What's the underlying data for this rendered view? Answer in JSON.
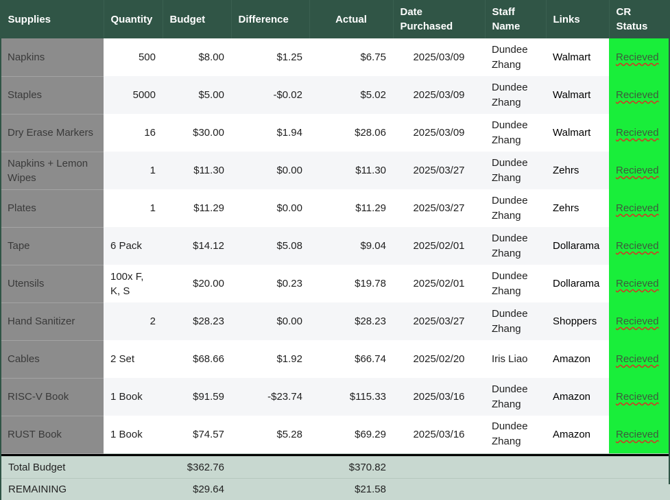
{
  "headers": {
    "supplies": "Supplies",
    "quantity": "Quantity",
    "budget": "Budget",
    "difference": "Difference",
    "actual": "Actual",
    "date_purchased": "Date Purchased",
    "staff_name": "Staff Name",
    "links": "Links",
    "cr_status": "CR Status"
  },
  "rows": [
    {
      "supply": "Napkins",
      "quantity": "500",
      "budget": "$8.00",
      "difference": "$1.25",
      "actual": "$6.75",
      "date": "2025/03/09",
      "staff": "Dundee Zhang",
      "link": "Walmart",
      "status": "Recieved"
    },
    {
      "supply": "Staples",
      "quantity": "5000",
      "budget": "$5.00",
      "difference": "-$0.02",
      "actual": "$5.02",
      "date": "2025/03/09",
      "staff": "Dundee Zhang",
      "link": "Walmart",
      "status": "Recieved"
    },
    {
      "supply": "Dry Erase Markers",
      "quantity": "16",
      "budget": "$30.00",
      "difference": "$1.94",
      "actual": "$28.06",
      "date": "2025/03/09",
      "staff": "Dundee Zhang",
      "link": "Walmart",
      "status": "Recieved"
    },
    {
      "supply": "Napkins + Lemon Wipes",
      "quantity": "1",
      "budget": "$11.30",
      "difference": "$0.00",
      "actual": "$11.30",
      "date": "2025/03/27",
      "staff": "Dundee Zhang",
      "link": "Zehrs",
      "status": "Recieved"
    },
    {
      "supply": "Plates",
      "quantity": "1",
      "budget": "$11.29",
      "difference": "$0.00",
      "actual": "$11.29",
      "date": "2025/03/27",
      "staff": "Dundee Zhang",
      "link": "Zehrs",
      "status": "Recieved"
    },
    {
      "supply": "Tape",
      "quantity": "6 Pack",
      "budget": "$14.12",
      "difference": "$5.08",
      "actual": "$9.04",
      "date": "2025/02/01",
      "staff": "Dundee Zhang",
      "link": "Dollarama",
      "status": "Recieved"
    },
    {
      "supply": "Utensils",
      "quantity": "100x F, K, S",
      "budget": "$20.00",
      "difference": "$0.23",
      "actual": "$19.78",
      "date": "2025/02/01",
      "staff": "Dundee Zhang",
      "link": "Dollarama",
      "status": "Recieved"
    },
    {
      "supply": "Hand Sanitizer",
      "quantity": "2",
      "budget": "$28.23",
      "difference": "$0.00",
      "actual": "$28.23",
      "date": "2025/03/27",
      "staff": "Dundee Zhang",
      "link": "Shoppers",
      "status": "Recieved"
    },
    {
      "supply": "Cables",
      "quantity": "2 Set",
      "budget": "$68.66",
      "difference": "$1.92",
      "actual": "$66.74",
      "date": "2025/02/20",
      "staff": "Iris Liao",
      "link": "Amazon",
      "status": "Recieved"
    },
    {
      "supply": "RISC-V Book",
      "quantity": "1 Book",
      "budget": "$91.59",
      "difference": "-$23.74",
      "actual": "$115.33",
      "date": "2025/03/16",
      "staff": "Dundee Zhang",
      "link": "Amazon",
      "status": "Recieved"
    },
    {
      "supply": "RUST Book",
      "quantity": "1 Book",
      "budget": "$74.57",
      "difference": "$5.28",
      "actual": "$69.29",
      "date": "2025/03/16",
      "staff": "Dundee Zhang",
      "link": "Amazon",
      "status": "Recieved"
    }
  ],
  "totals": {
    "total_label": "Total Budget",
    "total_budget": "$362.76",
    "total_actual": "$370.82",
    "remaining_label": "REMAINING",
    "remaining_budget": "$29.64",
    "remaining_actual": "$21.58"
  },
  "colors": {
    "header_bg": "#305546",
    "supply_col_bg": "#8c8c8c",
    "status_col_bg": "#19ee3a",
    "footer_bg": "#c8d8d0"
  }
}
